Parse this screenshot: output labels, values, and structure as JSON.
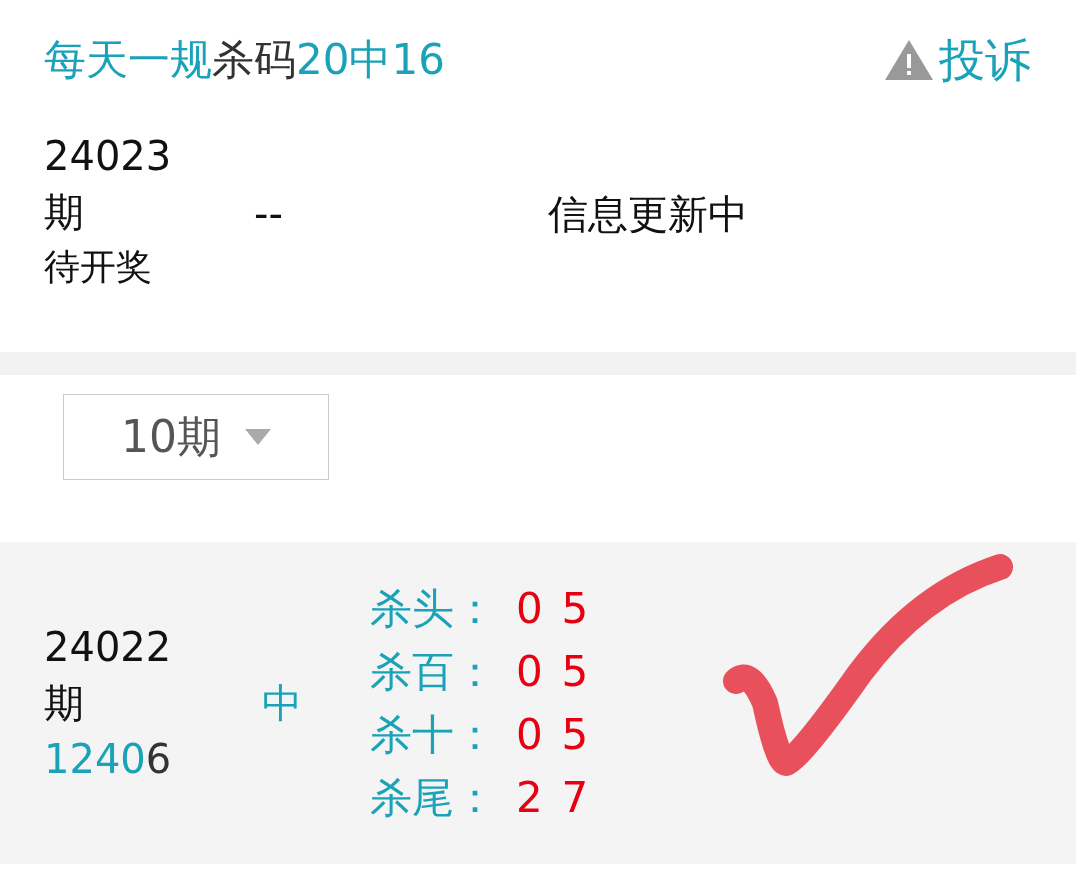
{
  "title": [
    {
      "text": "每天一规",
      "accent": true
    },
    {
      "text": "杀码",
      "accent": false
    },
    {
      "text": "20中16",
      "accent": true
    }
  ],
  "complaint": {
    "label": "投诉"
  },
  "current": {
    "period": "24023",
    "period_suffix": "期",
    "status": "待开奖",
    "result": "--",
    "message": "信息更新中"
  },
  "filter": {
    "value": "10期"
  },
  "history": [
    {
      "period": "24022",
      "period_suffix": "期",
      "draw": [
        {
          "text": "1240",
          "accent": true
        },
        {
          "text": "6",
          "accent": false
        }
      ],
      "outcome": "中",
      "checked": true,
      "kills": [
        {
          "label": "杀头：",
          "value": "05"
        },
        {
          "label": "杀百：",
          "value": "05"
        },
        {
          "label": "杀十：",
          "value": "05"
        },
        {
          "label": "杀尾：",
          "value": "27"
        }
      ]
    }
  ]
}
